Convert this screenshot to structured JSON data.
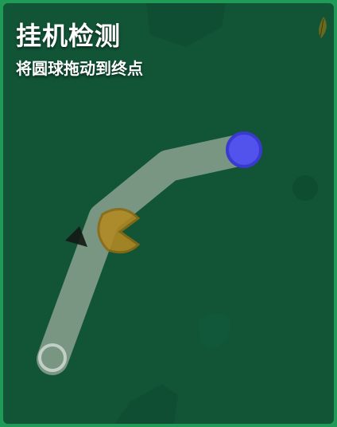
{
  "header": {
    "title": "挂机检测",
    "instruction": "将圆球拖动到终点"
  },
  "colors": {
    "background": "#115436",
    "border": "#1f9a57",
    "track": "#8fa593",
    "ball": "#5252ec",
    "ball_ring": "#3a3ad0",
    "obstacle_yellow": "#b48a22",
    "obstacle_dark": "#151a17"
  },
  "icons": {
    "ball": "draggable-ball",
    "goal": "goal-ring",
    "leaf": "leaf-icon",
    "triangle": "triangle-obstacle",
    "blob": "pacman-obstacle"
  }
}
